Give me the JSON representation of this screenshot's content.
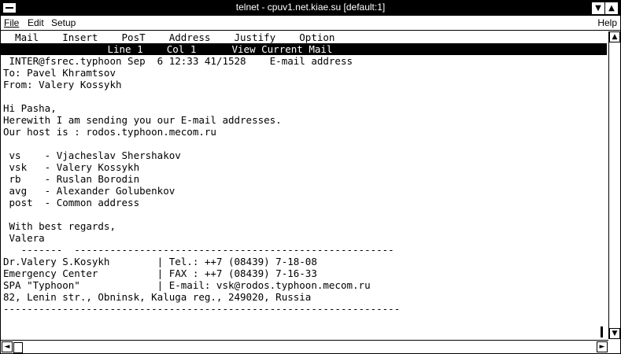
{
  "window": {
    "title": "telnet - cpuv1.net.kiae.su [default:1]"
  },
  "menubar": {
    "file": "File",
    "edit": "Edit",
    "setup": "Setup",
    "help": "Help"
  },
  "terminal": {
    "menu_line": "  Mail    Insert    PosT    Address    Justify    Option",
    "status_line": "                  Line 1    Col 1      View Current Mail",
    "header_line": " INTER@fsrec.typhoon Sep  6 12:33 41/1528    E-mail address",
    "to_line": "To: Pavel Khramtsov",
    "from_line": "From: Valery Kossykh",
    "greeting": "Hi Pasha,",
    "body1": "Herewith I am sending you our E-mail addresses.",
    "body2": "Our host is : rodos.typhoon.mecom.ru",
    "addr1": " vs    - Vjacheslav Shershakov",
    "addr2": " vsk   - Valery Kossykh",
    "addr3": " rb    - Ruslan Borodin",
    "addr4": " avg   - Alexander Golubenkov",
    "addr5": " post  - Common address",
    "regards": " With best regards,",
    "signname": " Valera",
    "sep1": "   -------  ------------------------------------------------------",
    "sig1": "Dr.Valery S.Kosykh        | Tel.: ++7 (08439) 7-18-08",
    "sig2": "Emergency Center          | FAX : ++7 (08439) 7-16-33",
    "sig3": "SPA \"Typhoon\"             | E-mail: vsk@rodos.typhoon.mecom.ru",
    "sig4": "82, Lenin str., Obninsk, Kaluga reg., 249020, Russia",
    "sep2": "-------------------------------------------------------------------"
  }
}
